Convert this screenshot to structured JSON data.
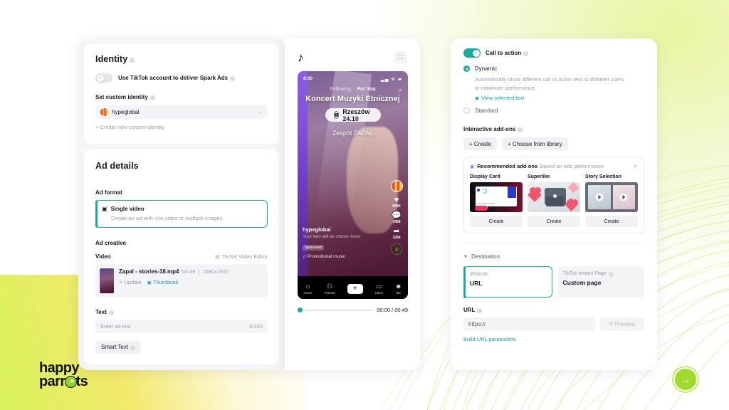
{
  "left": {
    "identity": {
      "title": "Identity",
      "spark_toggle_label": "Use TikTok account to deliver Spark Ads",
      "spark_toggle_state": "off",
      "custom_identity_label": "Set custom identity",
      "selected_identity": "hypeglobal",
      "create_new_link": "+ Create new custom identity"
    },
    "ad_details": {
      "title": "Ad details",
      "ad_format_label": "Ad format",
      "format_name": "Single video",
      "format_desc": "Create an ad with one video or multiple images.",
      "ad_creative_label": "Ad creative",
      "video_label": "Video",
      "video_editor_link": "TikTok Video Editor",
      "file_name": "Zapal - stories-18.mp4",
      "file_duration": "00:49",
      "file_resolution": "1080x1920",
      "update_link": "Update",
      "thumbnail_link": "Thumbnail",
      "text_label": "Text",
      "text_placeholder": "Enter ad text",
      "text_counter": "0/100",
      "smart_text_label": "Smart Text"
    }
  },
  "preview": {
    "logo_icon": "tiktok-logo-icon",
    "expand_icon": "expand-icon",
    "status_time": "8:00",
    "tab_following": "Following",
    "tab_foryou": "For You",
    "headline": "Koncert Muzyki Etnicznej",
    "event_pill": "Rzeszów 24.10",
    "subline": "Zespół ZAPAL",
    "account_name": "hypeglobal",
    "caption_placeholder": "Your text will be shown here",
    "sponsored_badge": "Sponsored",
    "music_label": "Promotional music",
    "like_count": "999K",
    "comment_count": "3456",
    "share_count": "1256",
    "nav": [
      {
        "label": "Home",
        "icon": "home-icon"
      },
      {
        "label": "Friends",
        "icon": "friends-icon"
      },
      {
        "label": "",
        "icon": "plus-icon"
      },
      {
        "label": "Inbox",
        "icon": "inbox-icon"
      },
      {
        "label": "Me",
        "icon": "profile-icon"
      }
    ],
    "time_current": "00:00",
    "time_total": "00:49",
    "time_display": "00:00 / 00:49"
  },
  "right": {
    "cta": {
      "toggle_label": "Call to action",
      "toggle_state": "on",
      "option_dynamic": "Dynamic",
      "dynamic_desc": "Automatically show different call to action text to different users to maximize performance.",
      "view_text_link": "View selected text",
      "option_standard": "Standard",
      "selected": "Dynamic"
    },
    "addons": {
      "section_label": "Interactive add-ons",
      "btn_create": "+ Create",
      "btn_library": "+ Choose from library",
      "rec_title": "Recommended add-ons",
      "rec_subtitle": "Based on ads performance",
      "close_icon": "close-icon",
      "items": [
        {
          "title": "Display Card",
          "button": "Create"
        },
        {
          "title": "Superlike",
          "button": "Create"
        },
        {
          "title": "Story Selection",
          "button": "Create"
        }
      ]
    },
    "destination": {
      "section_label": "Destination",
      "options": [
        {
          "kind": "Website",
          "value": "URL",
          "selected": true
        },
        {
          "kind": "TikTok Instant Page",
          "value": "Custom page",
          "selected": false
        }
      ],
      "url_label": "URL",
      "url_value": "https://",
      "preview_btn": "Preview",
      "build_params_link": "Build URL parameters"
    }
  },
  "brand": {
    "line1": "happy",
    "line2_a": "parr",
    "line2_b": "ts"
  },
  "next_button": {
    "icon": "arrow-right-icon"
  },
  "colors": {
    "accent_teal": "#18aaa4",
    "brand_green": "#9fdb2a",
    "tiktok_red": "#fe2c55",
    "tiktok_cyan": "#25f4ee"
  }
}
